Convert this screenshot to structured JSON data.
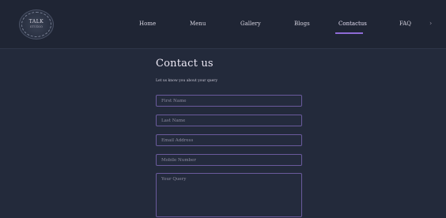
{
  "brand": {
    "logo_line1": "TALK",
    "logo_line2": "STUDIO"
  },
  "nav": {
    "items": [
      {
        "label": "Home"
      },
      {
        "label": "Menu"
      },
      {
        "label": "Gallery"
      },
      {
        "label": "Blogs"
      },
      {
        "label": "Contactus"
      },
      {
        "label": "FAQ"
      }
    ],
    "active": "Contactus",
    "more_icon": "chevron-right-icon",
    "accent_color": "#8e6bd6"
  },
  "contact": {
    "title": "Contact us",
    "subtitle": "Let us know you about your query",
    "fields": {
      "first_name": {
        "placeholder": "First Name"
      },
      "last_name": {
        "placeholder": "Last Name"
      },
      "email": {
        "placeholder": "Email Address"
      },
      "mobile": {
        "placeholder": "Mobile Number"
      },
      "query": {
        "placeholder": "Your Query"
      }
    }
  }
}
